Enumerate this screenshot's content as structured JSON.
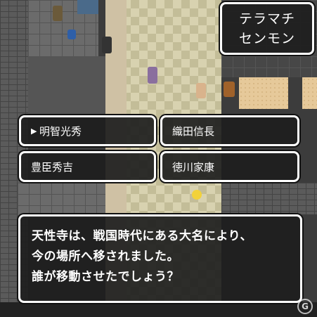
{
  "location": {
    "line1": "テラマチ",
    "line2": "センモン"
  },
  "choices": [
    {
      "label": "明智光秀",
      "selected": true
    },
    {
      "label": "織田信長",
      "selected": false
    },
    {
      "label": "豊臣秀吉",
      "selected": false
    },
    {
      "label": "徳川家康",
      "selected": false
    }
  ],
  "cursor_glyph": "▶",
  "message": {
    "line1": "天性寺は、戦国時代にある大名により、",
    "line2": "今の場所へ移されました。",
    "line3": "誰が移動させたでしょう？"
  },
  "colors": {
    "window_bg": "#1e1e1e",
    "window_border": "#ffffff",
    "text": "#ffffff"
  }
}
